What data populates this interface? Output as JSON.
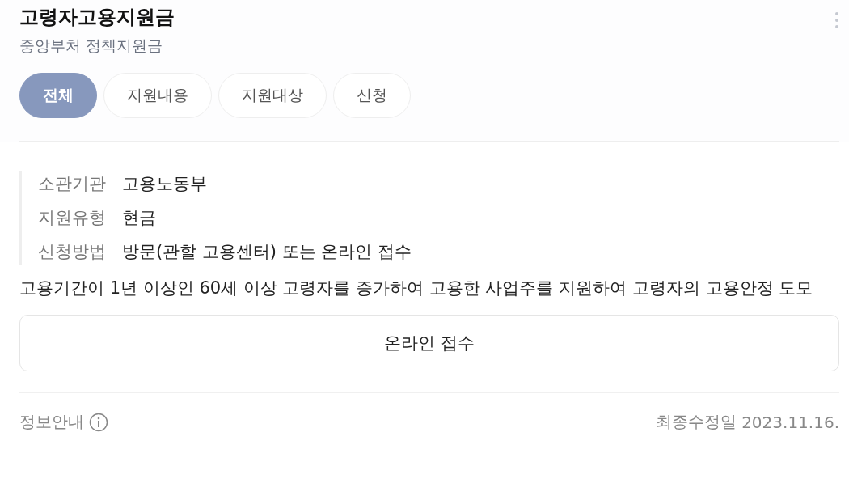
{
  "header": {
    "title": "고령자고용지원금",
    "subtitle": "중앙부처 정책지원금"
  },
  "tabs": [
    {
      "label": "전체",
      "selected": true
    },
    {
      "label": "지원내용",
      "selected": false
    },
    {
      "label": "지원대상",
      "selected": false
    },
    {
      "label": "신청",
      "selected": false
    }
  ],
  "info": [
    {
      "label": "소관기관",
      "value": "고용노동부"
    },
    {
      "label": "지원유형",
      "value": "현금"
    },
    {
      "label": "신청방법",
      "value": "방문(관할 고용센터) 또는 온라인 접수"
    }
  ],
  "description": "고용기간이 1년 이상인 60세 이상 고령자를 증가하여 고용한 사업주를 지원하여 고령자의 고용안정 도모",
  "apply_button": "온라인 접수",
  "footer": {
    "info_label": "정보안내",
    "updated_label": "최종수정일",
    "updated_date": "2023.11.16."
  }
}
